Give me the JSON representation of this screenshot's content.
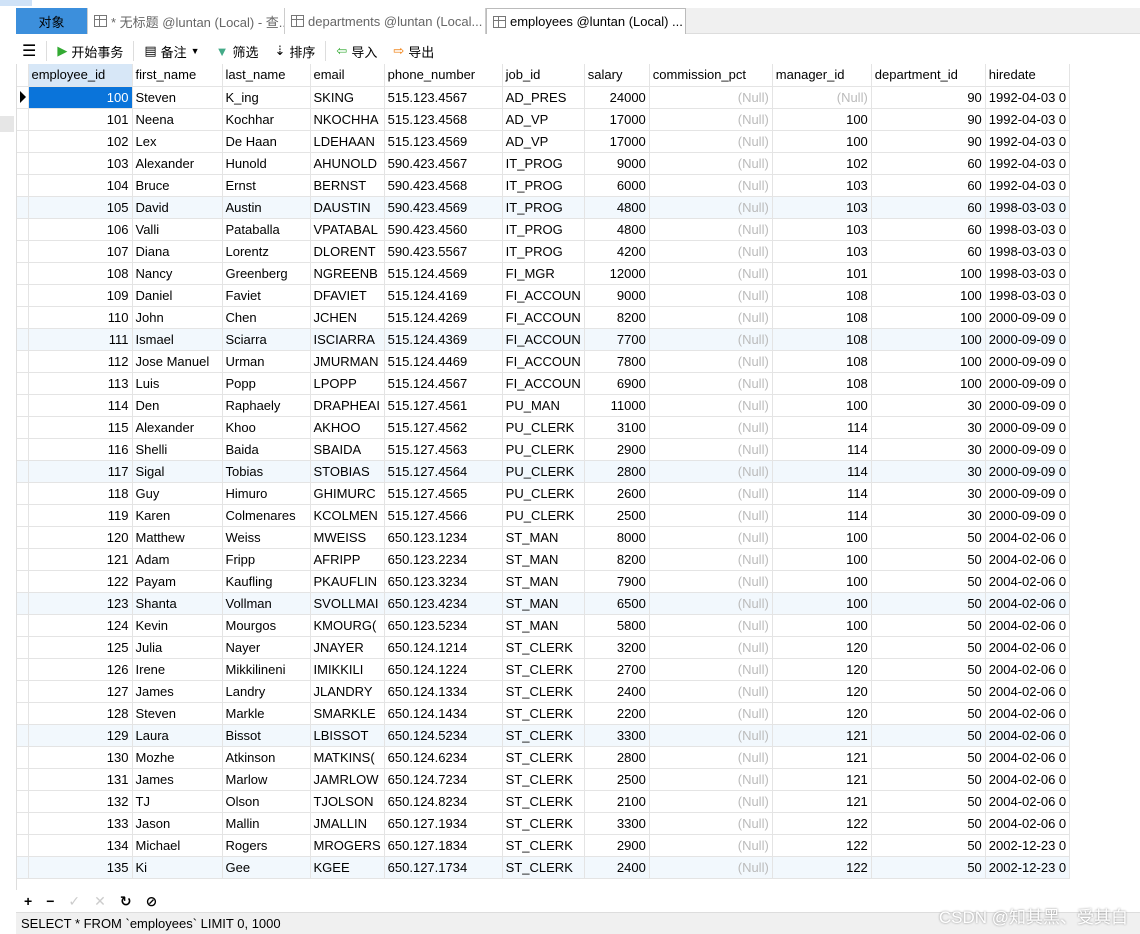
{
  "tabs": [
    {
      "label": "对象"
    },
    {
      "label": "* 无标题 @luntan (Local) - 查..."
    },
    {
      "label": "departments @luntan (Local..."
    },
    {
      "label": "employees @luntan (Local) ..."
    }
  ],
  "toolbar": {
    "begin": "开始事务",
    "note": "备注",
    "filter": "筛选",
    "sort": "排序",
    "import": "导入",
    "export": "导出"
  },
  "columns": [
    "employee_id",
    "first_name",
    "last_name",
    "email",
    "phone_number",
    "job_id",
    "salary",
    "commission_pct",
    "manager_id",
    "department_id",
    "hiredate"
  ],
  "rows": [
    [
      "100",
      "Steven",
      "K_ing",
      "SKING",
      "515.123.4567",
      "AD_PRES",
      "24000",
      "(Null)",
      "(Null)",
      "90",
      "1992-04-03 0"
    ],
    [
      "101",
      "Neena",
      "Kochhar",
      "NKOCHHA",
      "515.123.4568",
      "AD_VP",
      "17000",
      "(Null)",
      "100",
      "90",
      "1992-04-03 0"
    ],
    [
      "102",
      "Lex",
      "De Haan",
      "LDEHAAN",
      "515.123.4569",
      "AD_VP",
      "17000",
      "(Null)",
      "100",
      "90",
      "1992-04-03 0"
    ],
    [
      "103",
      "Alexander",
      "Hunold",
      "AHUNOLD",
      "590.423.4567",
      "IT_PROG",
      "9000",
      "(Null)",
      "102",
      "60",
      "1992-04-03 0"
    ],
    [
      "104",
      "Bruce",
      "Ernst",
      "BERNST",
      "590.423.4568",
      "IT_PROG",
      "6000",
      "(Null)",
      "103",
      "60",
      "1992-04-03 0"
    ],
    [
      "105",
      "David",
      "Austin",
      "DAUSTIN",
      "590.423.4569",
      "IT_PROG",
      "4800",
      "(Null)",
      "103",
      "60",
      "1998-03-03 0"
    ],
    [
      "106",
      "Valli",
      "Pataballa",
      "VPATABAL",
      "590.423.4560",
      "IT_PROG",
      "4800",
      "(Null)",
      "103",
      "60",
      "1998-03-03 0"
    ],
    [
      "107",
      "Diana",
      "Lorentz",
      "DLORENT",
      "590.423.5567",
      "IT_PROG",
      "4200",
      "(Null)",
      "103",
      "60",
      "1998-03-03 0"
    ],
    [
      "108",
      "Nancy",
      "Greenberg",
      "NGREENB",
      "515.124.4569",
      "FI_MGR",
      "12000",
      "(Null)",
      "101",
      "100",
      "1998-03-03 0"
    ],
    [
      "109",
      "Daniel",
      "Faviet",
      "DFAVIET",
      "515.124.4169",
      "FI_ACCOUN",
      "9000",
      "(Null)",
      "108",
      "100",
      "1998-03-03 0"
    ],
    [
      "110",
      "John",
      "Chen",
      "JCHEN",
      "515.124.4269",
      "FI_ACCOUN",
      "8200",
      "(Null)",
      "108",
      "100",
      "2000-09-09 0"
    ],
    [
      "111",
      "Ismael",
      "Sciarra",
      "ISCIARRA",
      "515.124.4369",
      "FI_ACCOUN",
      "7700",
      "(Null)",
      "108",
      "100",
      "2000-09-09 0"
    ],
    [
      "112",
      "Jose Manuel",
      "Urman",
      "JMURMAN",
      "515.124.4469",
      "FI_ACCOUN",
      "7800",
      "(Null)",
      "108",
      "100",
      "2000-09-09 0"
    ],
    [
      "113",
      "Luis",
      "Popp",
      "LPOPP",
      "515.124.4567",
      "FI_ACCOUN",
      "6900",
      "(Null)",
      "108",
      "100",
      "2000-09-09 0"
    ],
    [
      "114",
      "Den",
      "Raphaely",
      "DRAPHEAI",
      "515.127.4561",
      "PU_MAN",
      "11000",
      "(Null)",
      "100",
      "30",
      "2000-09-09 0"
    ],
    [
      "115",
      "Alexander",
      "Khoo",
      "AKHOO",
      "515.127.4562",
      "PU_CLERK",
      "3100",
      "(Null)",
      "114",
      "30",
      "2000-09-09 0"
    ],
    [
      "116",
      "Shelli",
      "Baida",
      "SBAIDA",
      "515.127.4563",
      "PU_CLERK",
      "2900",
      "(Null)",
      "114",
      "30",
      "2000-09-09 0"
    ],
    [
      "117",
      "Sigal",
      "Tobias",
      "STOBIAS",
      "515.127.4564",
      "PU_CLERK",
      "2800",
      "(Null)",
      "114",
      "30",
      "2000-09-09 0"
    ],
    [
      "118",
      "Guy",
      "Himuro",
      "GHIMURC",
      "515.127.4565",
      "PU_CLERK",
      "2600",
      "(Null)",
      "114",
      "30",
      "2000-09-09 0"
    ],
    [
      "119",
      "Karen",
      "Colmenares",
      "KCOLMEN",
      "515.127.4566",
      "PU_CLERK",
      "2500",
      "(Null)",
      "114",
      "30",
      "2000-09-09 0"
    ],
    [
      "120",
      "Matthew",
      "Weiss",
      "MWEISS",
      "650.123.1234",
      "ST_MAN",
      "8000",
      "(Null)",
      "100",
      "50",
      "2004-02-06 0"
    ],
    [
      "121",
      "Adam",
      "Fripp",
      "AFRIPP",
      "650.123.2234",
      "ST_MAN",
      "8200",
      "(Null)",
      "100",
      "50",
      "2004-02-06 0"
    ],
    [
      "122",
      "Payam",
      "Kaufling",
      "PKAUFLIN",
      "650.123.3234",
      "ST_MAN",
      "7900",
      "(Null)",
      "100",
      "50",
      "2004-02-06 0"
    ],
    [
      "123",
      "Shanta",
      "Vollman",
      "SVOLLMAI",
      "650.123.4234",
      "ST_MAN",
      "6500",
      "(Null)",
      "100",
      "50",
      "2004-02-06 0"
    ],
    [
      "124",
      "Kevin",
      "Mourgos",
      "KMOURG(",
      "650.123.5234",
      "ST_MAN",
      "5800",
      "(Null)",
      "100",
      "50",
      "2004-02-06 0"
    ],
    [
      "125",
      "Julia",
      "Nayer",
      "JNAYER",
      "650.124.1214",
      "ST_CLERK",
      "3200",
      "(Null)",
      "120",
      "50",
      "2004-02-06 0"
    ],
    [
      "126",
      "Irene",
      "Mikkilineni",
      "IMIKKILI",
      "650.124.1224",
      "ST_CLERK",
      "2700",
      "(Null)",
      "120",
      "50",
      "2004-02-06 0"
    ],
    [
      "127",
      "James",
      "Landry",
      "JLANDRY",
      "650.124.1334",
      "ST_CLERK",
      "2400",
      "(Null)",
      "120",
      "50",
      "2004-02-06 0"
    ],
    [
      "128",
      "Steven",
      "Markle",
      "SMARKLE",
      "650.124.1434",
      "ST_CLERK",
      "2200",
      "(Null)",
      "120",
      "50",
      "2004-02-06 0"
    ],
    [
      "129",
      "Laura",
      "Bissot",
      "LBISSOT",
      "650.124.5234",
      "ST_CLERK",
      "3300",
      "(Null)",
      "121",
      "50",
      "2004-02-06 0"
    ],
    [
      "130",
      "Mozhe",
      "Atkinson",
      "MATKINS(",
      "650.124.6234",
      "ST_CLERK",
      "2800",
      "(Null)",
      "121",
      "50",
      "2004-02-06 0"
    ],
    [
      "131",
      "James",
      "Marlow",
      "JAMRLOW",
      "650.124.7234",
      "ST_CLERK",
      "2500",
      "(Null)",
      "121",
      "50",
      "2004-02-06 0"
    ],
    [
      "132",
      "TJ",
      "Olson",
      "TJOLSON",
      "650.124.8234",
      "ST_CLERK",
      "2100",
      "(Null)",
      "121",
      "50",
      "2004-02-06 0"
    ],
    [
      "133",
      "Jason",
      "Mallin",
      "JMALLIN",
      "650.127.1934",
      "ST_CLERK",
      "3300",
      "(Null)",
      "122",
      "50",
      "2004-02-06 0"
    ],
    [
      "134",
      "Michael",
      "Rogers",
      "MROGERS",
      "650.127.1834",
      "ST_CLERK",
      "2900",
      "(Null)",
      "122",
      "50",
      "2002-12-23 0"
    ],
    [
      "135",
      "Ki",
      "Gee",
      "KGEE",
      "650.127.1734",
      "ST_CLERK",
      "2400",
      "(Null)",
      "122",
      "50",
      "2002-12-23 0"
    ]
  ],
  "bottom": {
    "add": "+",
    "remove": "−",
    "apply": "✓",
    "discard": "✕",
    "refresh": "↻",
    "stop": "⊘"
  },
  "status": {
    "query": "SELECT * FROM `employees` LIMIT 0, 1000"
  },
  "watermark": "CSDN @知其黑、受其白",
  "colors": {
    "accent": "#0a74da",
    "tab_object": "#3c8fdc"
  }
}
